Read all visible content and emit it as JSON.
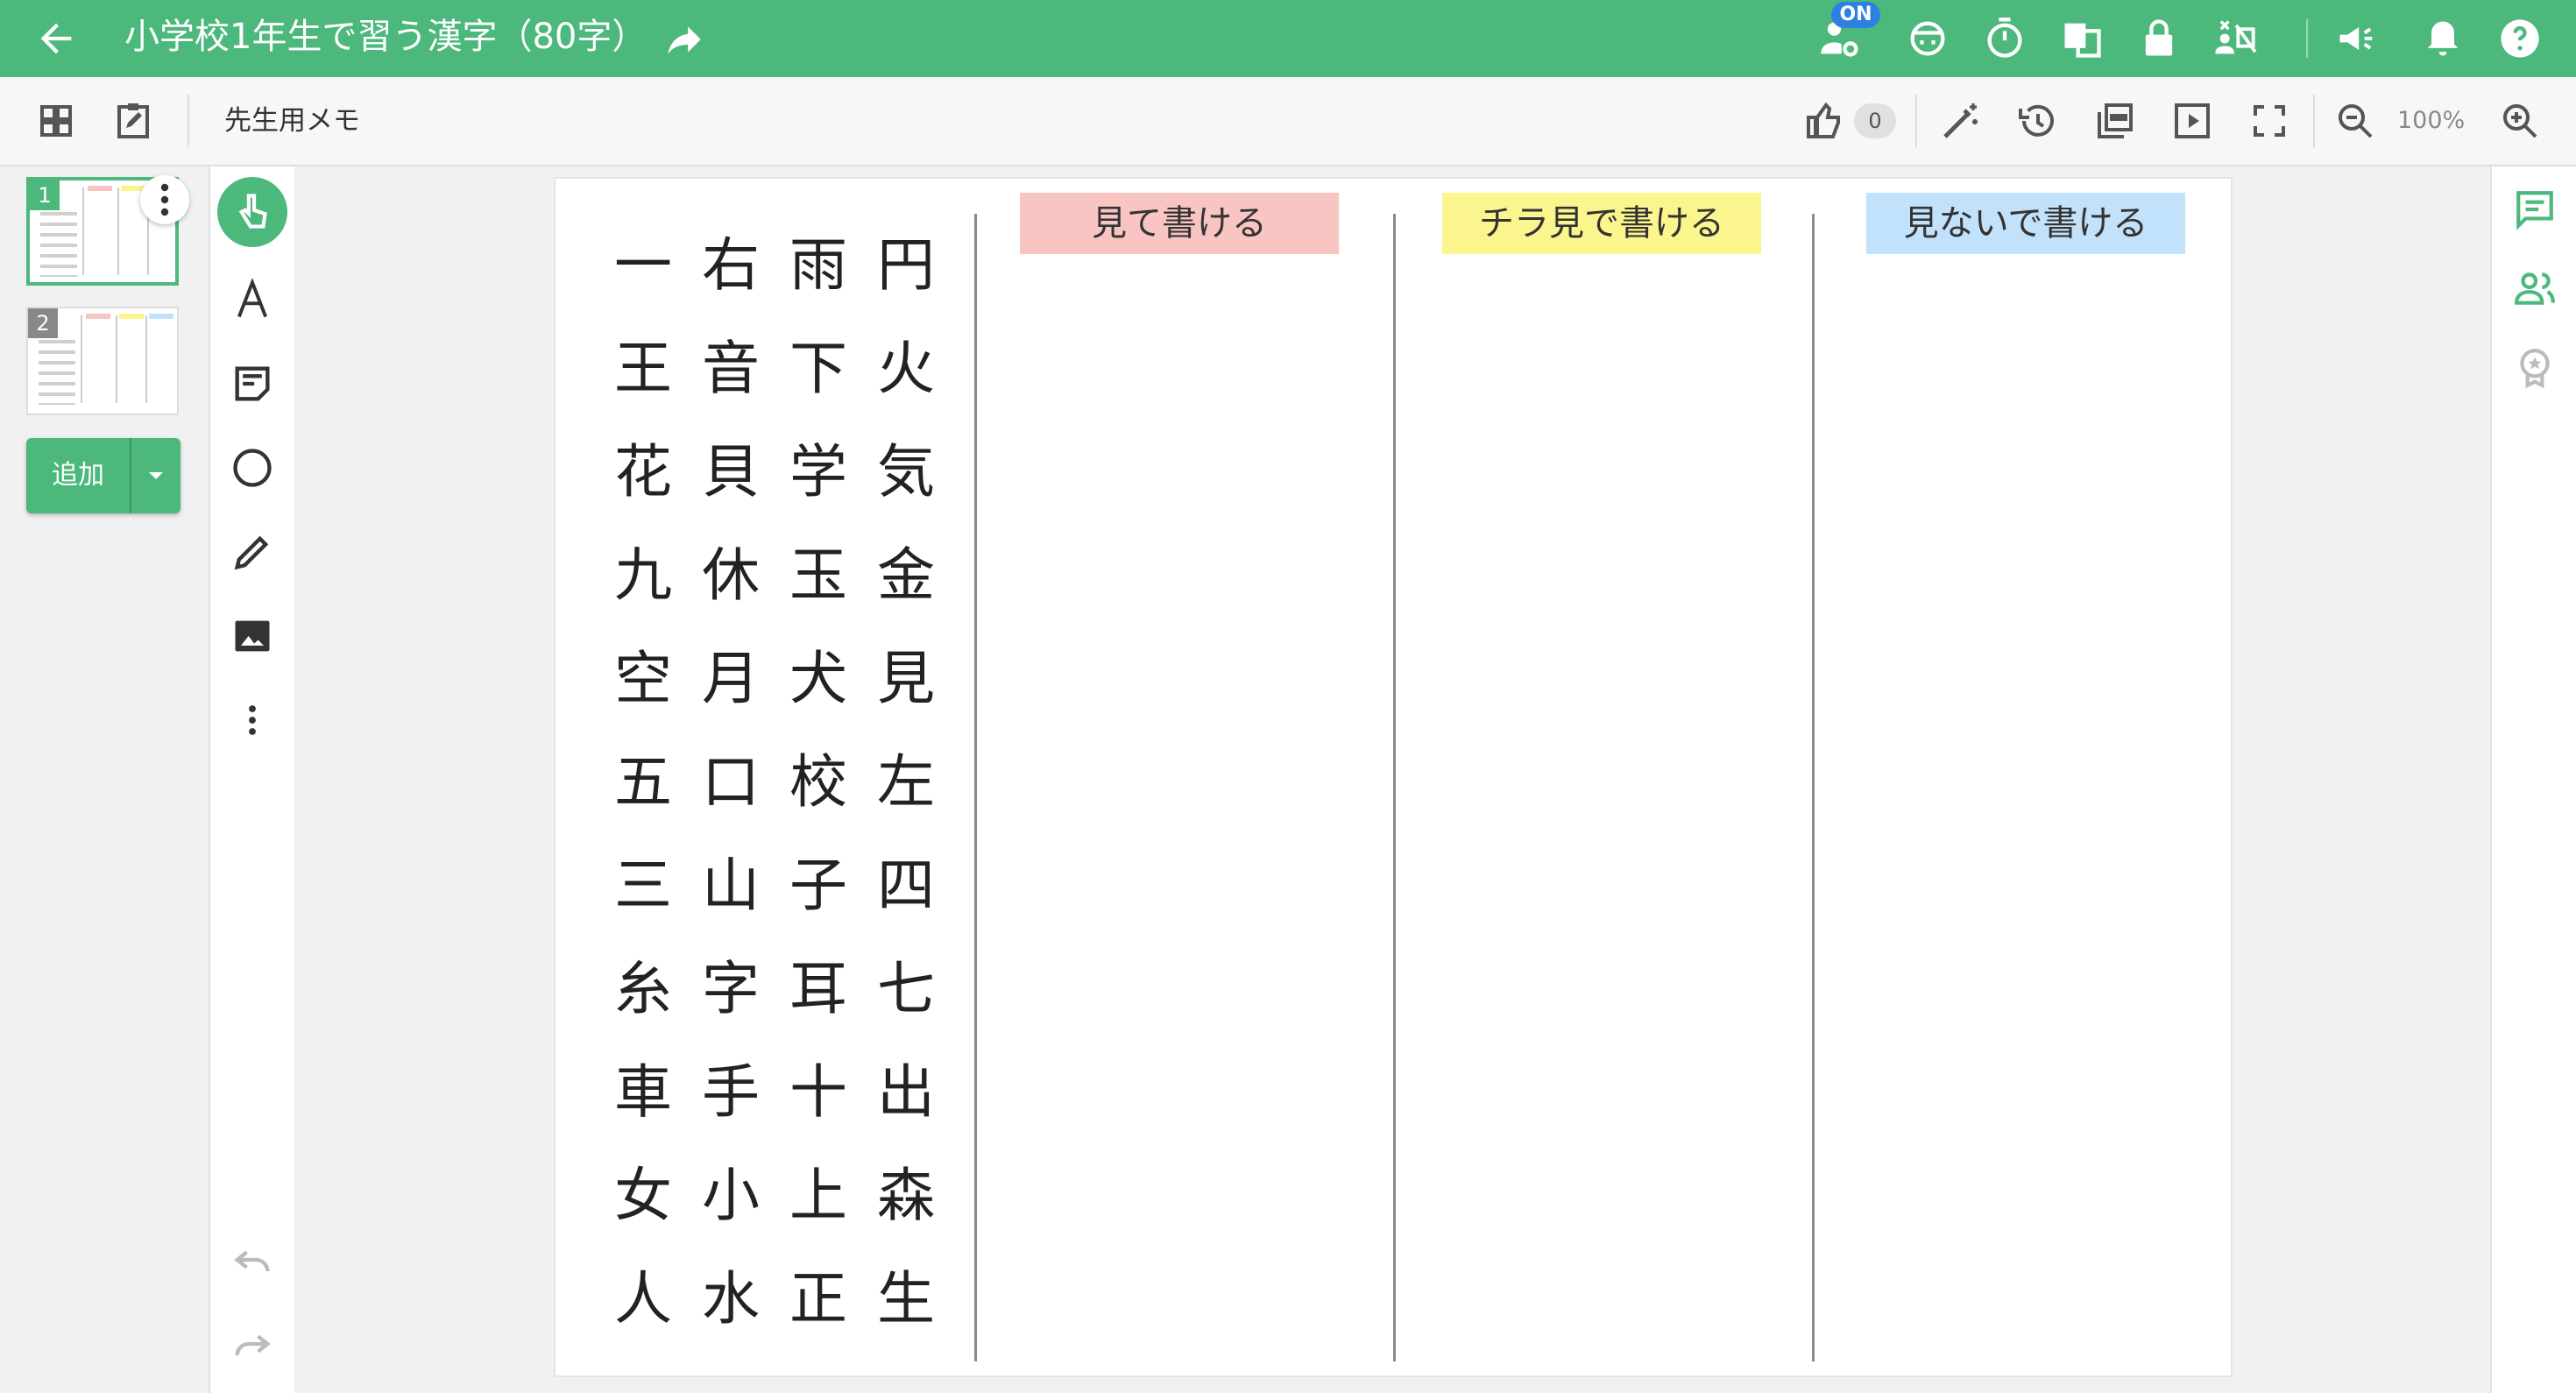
{
  "header": {
    "title": "小学校1年生で習う漢字（80字）",
    "on_badge": "ON"
  },
  "toolbar": {
    "memo_label": "先生用メモ",
    "like_count": "0",
    "zoom_level": "100%"
  },
  "slides": [
    {
      "number": "1"
    },
    {
      "number": "2"
    }
  ],
  "add_button": {
    "label": "追加"
  },
  "board": {
    "kanji": [
      "一",
      "右",
      "雨",
      "円",
      "王",
      "音",
      "下",
      "火",
      "花",
      "貝",
      "学",
      "気",
      "九",
      "休",
      "玉",
      "金",
      "空",
      "月",
      "犬",
      "見",
      "五",
      "口",
      "校",
      "左",
      "三",
      "山",
      "子",
      "四",
      "糸",
      "字",
      "耳",
      "七",
      "車",
      "手",
      "十",
      "出",
      "女",
      "小",
      "上",
      "森",
      "人",
      "水",
      "正",
      "生"
    ],
    "columns": [
      {
        "label": "見て書ける",
        "color": "#f8c5c2"
      },
      {
        "label": "チラ見で書ける",
        "color": "#fbf58d"
      },
      {
        "label": "見ないで書ける",
        "color": "#c2e1fa"
      }
    ]
  },
  "colors": {
    "accent": "#4cb87c",
    "on_badge": "#2f7fe0"
  }
}
